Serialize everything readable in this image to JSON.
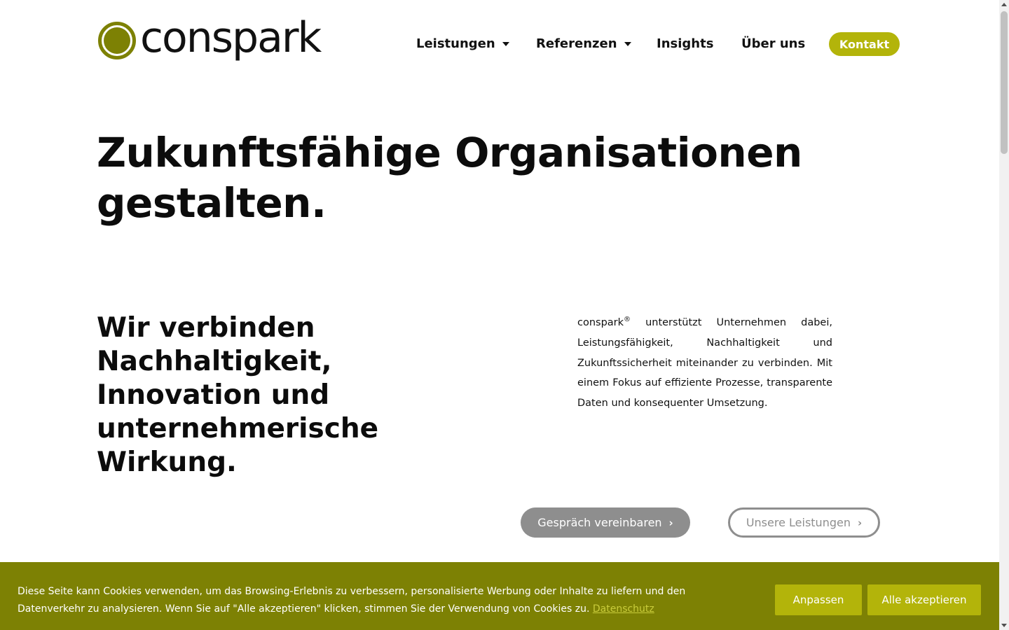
{
  "header": {
    "logo_text": "conspark",
    "nav": [
      {
        "label": "Leistungen",
        "has_dropdown": true
      },
      {
        "label": "Referenzen",
        "has_dropdown": true
      },
      {
        "label": "Insights",
        "has_dropdown": false
      },
      {
        "label": "Über uns",
        "has_dropdown": false
      }
    ],
    "cta_label": "Kontakt"
  },
  "hero": {
    "title_line1": "Zukunftsfähige Organisationen",
    "title_line2": "gestalten.",
    "subtitle": "Wir verbinden Nachhaltigkeit, Innovation und unternehmerische Wirkung.",
    "intro_brand": "conspark",
    "intro_mark": "®",
    "intro_text": " unterstützt Unternehmen dabei, Leistungsfähigkeit, Nachhaltigkeit und Zukunftssicherheit miteinander zu verbinden. Mit einem Fokus auf effiziente Prozesse, transparente Daten und konsequenter Umsetzung.",
    "primary_button": "Gespräch vereinbaren",
    "secondary_button": "Unsere Leistungen"
  },
  "cookie_banner": {
    "text": "Diese Seite kann Cookies verwenden, um das Browsing-Erlebnis zu verbessern, personalisierte Werbung oder Inhalte zu liefern und den Datenverkehr zu analysieren. Wenn Sie auf \"Alle akzeptieren\" klicken, stimmen Sie der Verwendung von Cookies zu. ",
    "link_label": "Datenschutz",
    "customize_label": "Anpassen",
    "accept_label": "Alle akzeptieren"
  },
  "icons": {
    "dropdown": "caret-down-icon",
    "button_arrow": "chevron-right-icon"
  },
  "colors": {
    "brand_olive": "#7d8104",
    "accent_lime": "#b3b40a",
    "muted_gray": "#8e8e8e"
  }
}
